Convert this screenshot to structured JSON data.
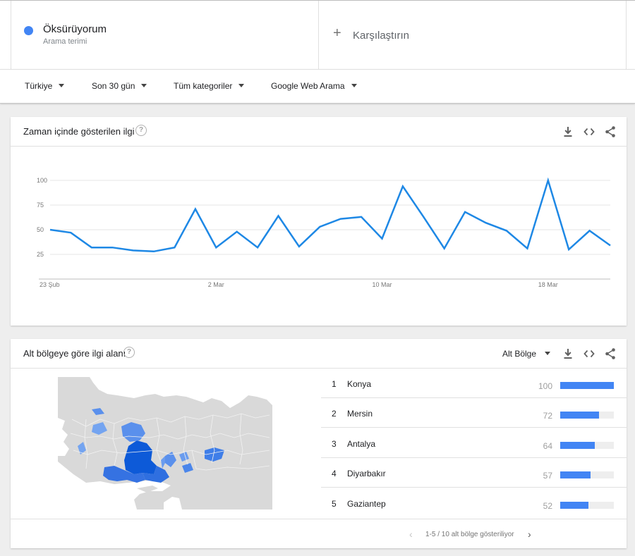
{
  "search_term": {
    "name": "Öksürüyorum",
    "subtitle": "Arama terimi",
    "color": "#4285f4"
  },
  "compare": {
    "label": "Karşılaştırın",
    "icon": "plus-icon"
  },
  "filters": [
    {
      "label": "Türkiye"
    },
    {
      "label": "Son 30 gün"
    },
    {
      "label": "Tüm kategoriler"
    },
    {
      "label": "Google Web Arama"
    }
  ],
  "interest_over_time": {
    "title": "Zaman içinde gösterilen ilgi",
    "icons": [
      "help-icon",
      "download-icon",
      "embed-icon",
      "share-icon"
    ]
  },
  "chart_data": {
    "type": "line",
    "title": "",
    "xlabel": "",
    "ylabel": "",
    "ylim": [
      0,
      100
    ],
    "yticks": [
      25,
      50,
      75,
      100
    ],
    "x_tick_labels": [
      {
        "label": "23 Şub",
        "index": 0
      },
      {
        "label": "2 Mar",
        "index": 8
      },
      {
        "label": "10 Mar",
        "index": 16
      },
      {
        "label": "18 Mar",
        "index": 24
      }
    ],
    "grid": true,
    "series": [
      {
        "color": "#1e88e5",
        "values": [
          50,
          47,
          32,
          32,
          29,
          28,
          32,
          71,
          32,
          48,
          32,
          64,
          33,
          53,
          61,
          63,
          41,
          94,
          63,
          31,
          68,
          57,
          49,
          31,
          100,
          30,
          49,
          34
        ]
      }
    ]
  },
  "subregion": {
    "title": "Alt bölgeye göre ilgi alanı",
    "region_select": "Alt Bölge",
    "icons": [
      "help-icon",
      "download-icon",
      "embed-icon",
      "share-icon"
    ],
    "rows": [
      {
        "rank": "1",
        "name": "Konya",
        "value": 100
      },
      {
        "rank": "2",
        "name": "Mersin",
        "value": 72
      },
      {
        "rank": "3",
        "name": "Antalya",
        "value": 64
      },
      {
        "rank": "4",
        "name": "Diyarbakır",
        "value": 57
      },
      {
        "rank": "5",
        "name": "Gaziantep",
        "value": 52
      }
    ],
    "pager_text": "1-5 / 10 alt bölge gösteriliyor",
    "map_colors": {
      "land": "#d9d9d9",
      "sea": "#ffffff",
      "high": "#0d5ad8",
      "mid": "#3f7ee8",
      "low": "#74a4f0"
    }
  }
}
